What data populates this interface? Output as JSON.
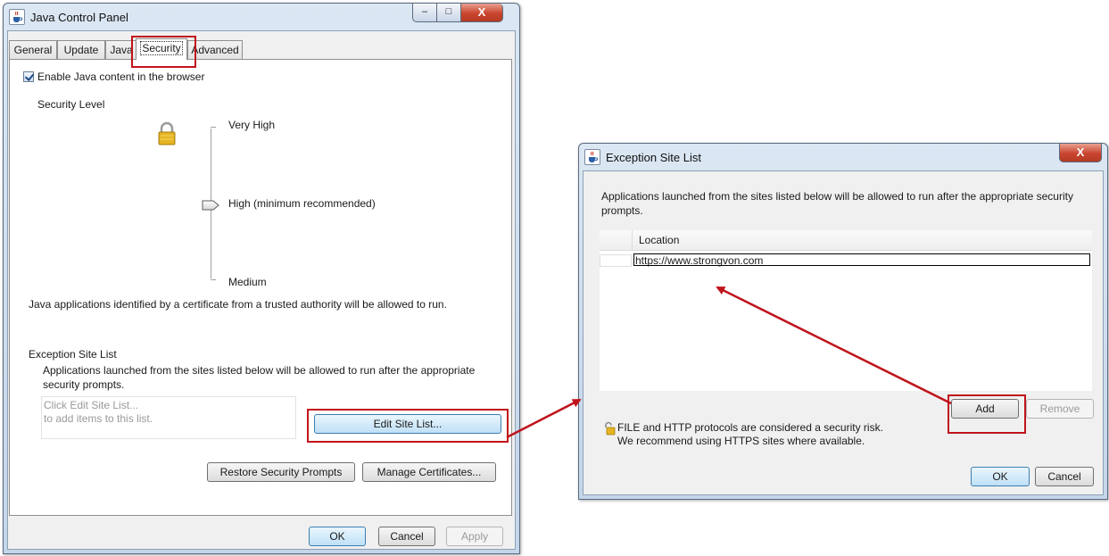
{
  "java_control_panel": {
    "title": "Java Control Panel",
    "caption_buttons": {
      "minimize": "–",
      "maximize": "□",
      "close": "X"
    },
    "tabs": [
      {
        "label": "General"
      },
      {
        "label": "Update"
      },
      {
        "label": "Java"
      },
      {
        "label": "Security",
        "active": true
      },
      {
        "label": "Advanced"
      }
    ],
    "enable_java_label": "Enable Java content in the browser",
    "enable_java_checked": true,
    "security_level_heading": "Security Level",
    "levels": {
      "very_high": "Very High",
      "high": "High (minimum recommended)",
      "medium": "Medium"
    },
    "selected_level": "high",
    "level_description": "Java applications identified by a certificate from a trusted authority will be allowed to run.",
    "exception_site_list_heading": "Exception Site List",
    "exception_site_list_desc_1": "Applications launched from the sites listed below will be allowed to run after the appropriate",
    "exception_site_list_desc_2": "security prompts.",
    "site_list_placeholder_1": "Click Edit Site List...",
    "site_list_placeholder_2": "to add items to this list.",
    "edit_site_list_button": "Edit Site List...",
    "restore_prompts_button": "Restore Security Prompts",
    "manage_certificates_button": "Manage Certificates...",
    "ok_button": "OK",
    "cancel_button": "Cancel",
    "apply_button": "Apply"
  },
  "exception_site_list_dialog": {
    "title": "Exception Site List",
    "close_button": "X",
    "description_1": "Applications launched from the sites listed below will be allowed to run after the appropriate security",
    "description_2": "prompts.",
    "table_header_location": "Location",
    "rows": [
      {
        "location": "https://www.strongvon.com"
      }
    ],
    "add_button": "Add",
    "remove_button": "Remove",
    "warning_line_1": "FILE and HTTP protocols are considered a security risk.",
    "warning_line_2": "We recommend using HTTPS sites where available.",
    "ok_button": "OK",
    "cancel_button": "Cancel"
  },
  "colors": {
    "annotation_red": "#c0141c",
    "window_frame": "#c4d6ea",
    "default_button": "#bfe0f7"
  }
}
